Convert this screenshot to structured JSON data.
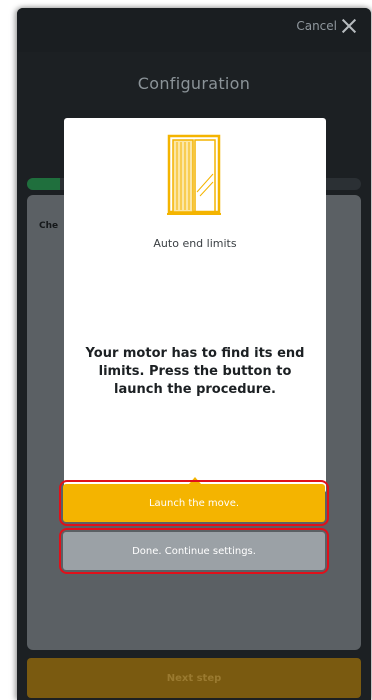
{
  "header": {
    "cancel_label": "Cancel",
    "close_icon": "close-icon"
  },
  "background": {
    "title": "Configuration",
    "card_label": "Che",
    "progress": 0.1,
    "next_step_label": "Next step"
  },
  "modal": {
    "icon": "sliding-door-icon",
    "subtitle": "Auto end limits",
    "message": "Your motor has to find its end limits. Press the button to launch the procedure.",
    "launch_button": "Launch the move.",
    "done_button": "Done. Continue settings."
  },
  "colors": {
    "accent": "#f4b400",
    "progress_green": "#1f6f3d",
    "done_gray": "#9ba1a6",
    "highlight_red": "#e0101a"
  }
}
